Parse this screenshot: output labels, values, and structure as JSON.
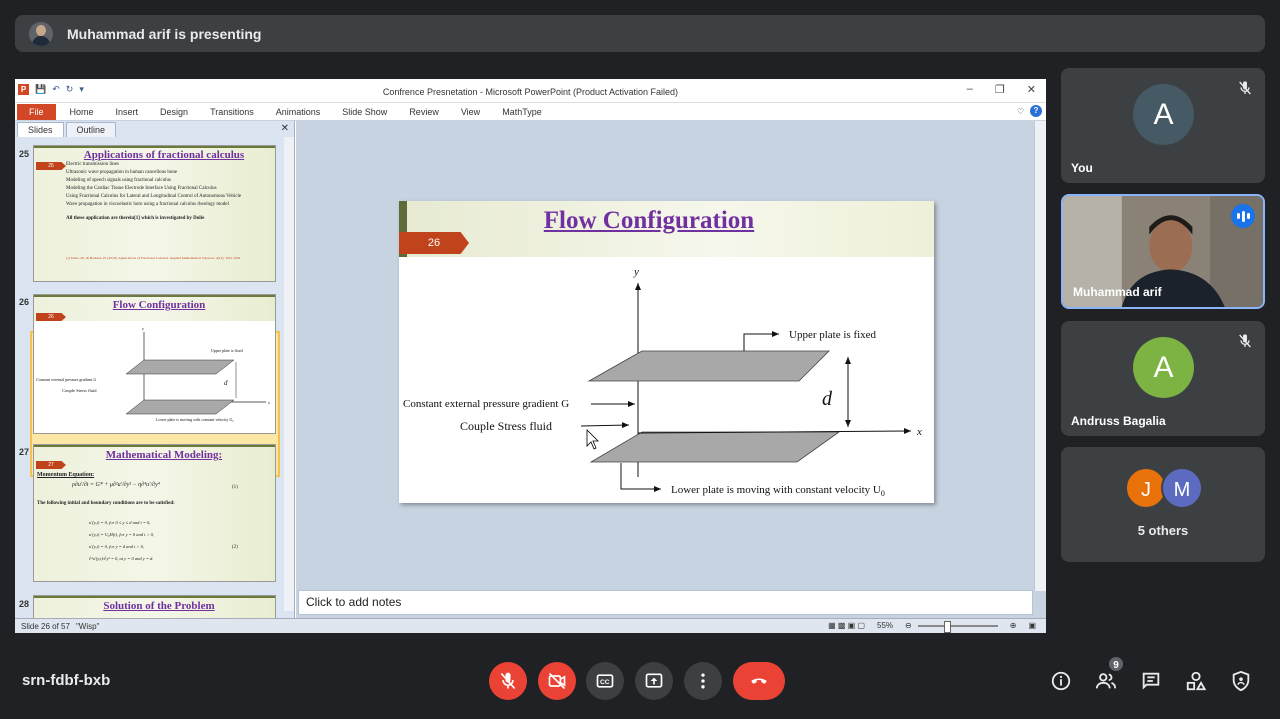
{
  "meeting": {
    "presenting_text": "Muhammad arif is presenting",
    "meeting_code": "srn-fdbf-bxb",
    "people_count": "9"
  },
  "ppt": {
    "window_title": "Confrence Presnetation  -  Microsoft PowerPoint (Product Activation Failed)",
    "file_tab": "File",
    "tabs": [
      "Home",
      "Insert",
      "Design",
      "Transitions",
      "Animations",
      "Slide Show",
      "Review",
      "View",
      "MathType"
    ],
    "panel_tabs": [
      "Slides",
      "Outline"
    ],
    "notes_placeholder": "Click to add notes",
    "status": {
      "slide_info": "Slide 26 of 57",
      "theme": "\"Wisp\"",
      "zoom": "55%"
    }
  },
  "thumbnails": [
    {
      "number": "25",
      "badge": "25",
      "title": "Applications of fractional calculus",
      "bullets": [
        "Electric transmission lines",
        "Ultrasonic wave propagation in human cancellous bone",
        "Modeling of speech signals using fractional calculus",
        "Modeling the Cardiac Tissue Electrode Interface Using Fractional Calculus",
        "Using Fractional Calculus for Lateral and Longitudinal Control of Autonomous Vehicle",
        "Wave propagation in viscoelastic horn using a fractional calculus rheology model"
      ],
      "footer": "All these application are therein[1] which is investigated by Dolie",
      "ref": "[1] Dolie, M., & Barkana, B. (2018). Applications of Fractional Calculus. Applied Mathematical Sciences, 4(15), 1021-1032"
    },
    {
      "number": "26",
      "badge": "26",
      "title": "Flow Configuration",
      "labels": [
        "Upper plate is fixed",
        "Constant external pressure gradient G",
        "Couple Stress fluid",
        "Lower plate is moving with constant velocity U₀",
        "d",
        "y",
        "x"
      ]
    },
    {
      "number": "27",
      "badge": "27",
      "title": "Mathematical Modeling:",
      "subtitle": "Momentum Equation:",
      "eq1_label": "(1)",
      "bc_text": "The following initial and boundary conditions are to be satisfied:",
      "bc_lines": [
        "u′(y,t) = 0,   for 0 ≤ y ≤ d  and  t = 0,",
        "u′(y,t) = U₀H(t),   for y = 0  and  t > 0,",
        "u′(y,t) = 0,   for y = d  and  t > 0,",
        "∂²u′(y,t)/∂y² = 0, at y = 0 and y = d."
      ],
      "eq2_label": "(2)"
    },
    {
      "number": "28",
      "badge": "28",
      "title": "Solution  of the Problem"
    }
  ],
  "slide": {
    "number": "26",
    "title": "Flow Configuration",
    "y_label": "y",
    "x_label": "x",
    "upper_label": "Upper plate is fixed",
    "pressure_label": "Constant external pressure gradient G",
    "fluid_label": "Couple Stress fluid",
    "lower_label": "Lower plate is moving with constant velocity U",
    "lower_label_sub": "0",
    "d_label": "d"
  },
  "participants": [
    {
      "name": "You",
      "initial": "A",
      "color": "#455a64",
      "muted": true
    },
    {
      "name": "Muhammad arif",
      "speaking": true
    },
    {
      "name": "Andruss Bagalia",
      "initial": "A",
      "color": "#7cb342",
      "muted": true
    },
    {
      "name": "5 others",
      "initials": [
        "J",
        "M"
      ],
      "colors": [
        "#e8710a",
        "#5c6bc0"
      ]
    }
  ],
  "colors": {
    "end_call": "#ea4335",
    "accent": "#8ab4f8",
    "ppt_orange": "#d24726"
  }
}
